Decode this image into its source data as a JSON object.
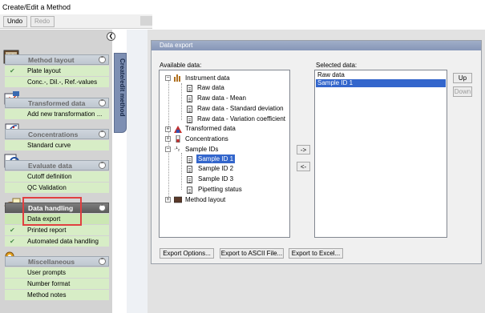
{
  "window": {
    "title": "Create/Edit a Method"
  },
  "toolbar": {
    "undo_label": "Undo",
    "redo_label": "Redo"
  },
  "sidebar": {
    "vertical_tab": "Create/edit method",
    "sections": [
      {
        "title": "Method layout",
        "items": [
          "Plate layout",
          "Conc.-, Dil.-, Ref.-values"
        ]
      },
      {
        "title": "Transformed data",
        "items": [
          "Add new transformation ..."
        ]
      },
      {
        "title": "Concentrations",
        "items": [
          "Standard curve"
        ]
      },
      {
        "title": "Evaluate data",
        "items": [
          "Cutoff definition",
          "QC Validation"
        ]
      },
      {
        "title": "Data handling",
        "items": [
          "Data export",
          "Printed report",
          "Automated data handling"
        ]
      },
      {
        "title": "Miscellaneous",
        "items": [
          "User prompts",
          "Number format",
          "Method notes"
        ]
      }
    ]
  },
  "panel": {
    "title": "Data export",
    "available_label": "Available data:",
    "selected_label": "Selected data:",
    "tree": {
      "instrument": "Instrument data",
      "raw": "Raw data",
      "raw_mean": "Raw data - Mean",
      "raw_sd": "Raw data - Standard deviation",
      "raw_cv": "Raw data - Variation coefficient",
      "transformed": "Transformed data",
      "concentrations": "Concentrations",
      "sample_ids": "Sample IDs",
      "sid1": "Sample ID 1",
      "sid2": "Sample ID 2",
      "sid3": "Sample ID 3",
      "pipetting": "Pipetting status",
      "method_layout": "Method layout"
    },
    "add_button": "->",
    "remove_button": "<-",
    "selected_items": [
      "Raw data",
      "Sample ID 1"
    ],
    "up_button": "Up",
    "down_button": "Down",
    "export_options": "Export Options...",
    "export_ascii": "Export to ASCII File...",
    "export_excel": "Export to Excel..."
  },
  "colors": {
    "accent_selected": "#3366cc",
    "highlight_box": "#e04040",
    "item_green": "#d7edc6"
  }
}
